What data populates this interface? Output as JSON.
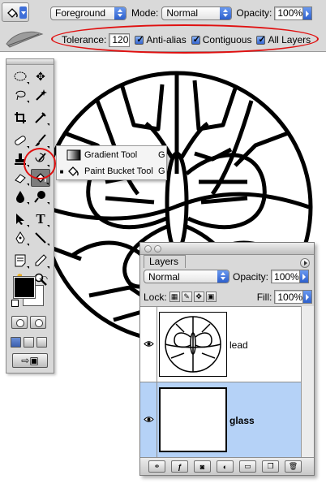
{
  "options_bar": {
    "fill_source": "Foreground",
    "mode_label": "Mode:",
    "mode_value": "Normal",
    "opacity_label": "Opacity:",
    "opacity_value": "100%",
    "tolerance_label": "Tolerance:",
    "tolerance_value": "120",
    "anti_alias_label": "Anti-alias",
    "contiguous_label": "Contiguous",
    "all_layers_label": "All Layers",
    "anti_alias_checked": true,
    "contiguous_checked": true,
    "all_layers_checked": true
  },
  "tool_flyout": {
    "items": [
      {
        "label": "Gradient Tool",
        "shortcut": "G",
        "icon": "gradient-icon",
        "active": false
      },
      {
        "label": "Paint Bucket Tool",
        "shortcut": "G",
        "icon": "paint-bucket-icon",
        "active": true
      }
    ]
  },
  "toolbox": {
    "tools": [
      "marquee-icon",
      "move-icon",
      "lasso-icon",
      "magic-wand-icon",
      "crop-icon",
      "slice-icon",
      "healing-brush-icon",
      "brush-icon",
      "clone-stamp-icon",
      "history-brush-icon",
      "eraser-icon",
      "paint-bucket-icon",
      "blur-icon",
      "dodge-icon",
      "path-selection-icon",
      "type-icon",
      "pen-icon",
      "line-icon",
      "notes-icon",
      "eyedropper-icon",
      "hand-icon",
      "zoom-icon"
    ],
    "selected_tool": "paint-bucket-icon",
    "foreground_color": "#000000",
    "background_color": "#ffffff"
  },
  "layers_panel": {
    "tab_label": "Layers",
    "blend_mode": "Normal",
    "opacity_label": "Opacity:",
    "opacity_value": "100%",
    "lock_label": "Lock:",
    "fill_label": "Fill:",
    "fill_value": "100%",
    "layers": [
      {
        "name": "lead",
        "visible": true,
        "active": false
      },
      {
        "name": "glass",
        "visible": true,
        "active": true
      }
    ]
  },
  "colors": {
    "annotation_red": "#e01010",
    "selection_blue": "#b5d2f7",
    "aqua_blue": "#3565d0"
  }
}
